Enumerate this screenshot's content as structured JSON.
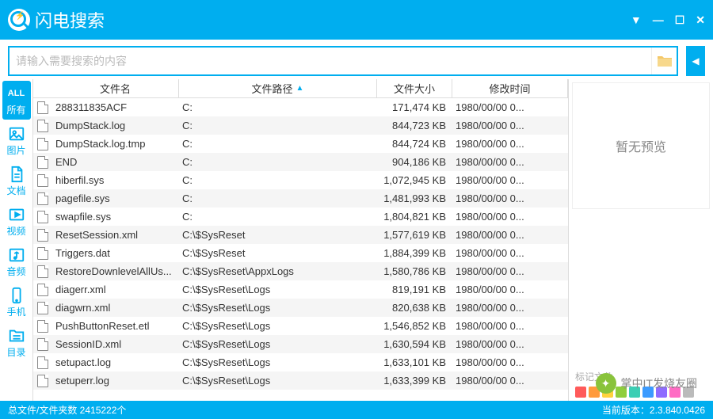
{
  "app": {
    "title": "闪电搜索"
  },
  "window_controls": {
    "menu": "▼",
    "minimize": "—",
    "maximize": "☐",
    "close": "✕"
  },
  "search": {
    "placeholder": "请输入需要搜索的内容"
  },
  "sidebar": {
    "items": [
      {
        "label": "所有",
        "icon": "ALL"
      },
      {
        "label": "图片"
      },
      {
        "label": "文档"
      },
      {
        "label": "视频"
      },
      {
        "label": "音频"
      },
      {
        "label": "手机"
      },
      {
        "label": "目录"
      }
    ]
  },
  "columns": {
    "name": "文件名",
    "path": "文件路径",
    "size": "文件大小",
    "date": "修改时间"
  },
  "rows": [
    {
      "name": "288311835ACF",
      "path": "C:",
      "size": "171,474 KB",
      "date": "1980/00/00 0..."
    },
    {
      "name": "DumpStack.log",
      "path": "C:",
      "size": "844,723 KB",
      "date": "1980/00/00 0..."
    },
    {
      "name": "DumpStack.log.tmp",
      "path": "C:",
      "size": "844,724 KB",
      "date": "1980/00/00 0..."
    },
    {
      "name": "END",
      "path": "C:",
      "size": "904,186 KB",
      "date": "1980/00/00 0..."
    },
    {
      "name": "hiberfil.sys",
      "path": "C:",
      "size": "1,072,945 KB",
      "date": "1980/00/00 0..."
    },
    {
      "name": "pagefile.sys",
      "path": "C:",
      "size": "1,481,993 KB",
      "date": "1980/00/00 0..."
    },
    {
      "name": "swapfile.sys",
      "path": "C:",
      "size": "1,804,821 KB",
      "date": "1980/00/00 0..."
    },
    {
      "name": "ResetSession.xml",
      "path": "C:\\$SysReset",
      "size": "1,577,619 KB",
      "date": "1980/00/00 0..."
    },
    {
      "name": "Triggers.dat",
      "path": "C:\\$SysReset",
      "size": "1,884,399 KB",
      "date": "1980/00/00 0..."
    },
    {
      "name": "RestoreDownlevelAllUs...",
      "path": "C:\\$SysReset\\AppxLogs",
      "size": "1,580,786 KB",
      "date": "1980/00/00 0..."
    },
    {
      "name": "diagerr.xml",
      "path": "C:\\$SysReset\\Logs",
      "size": "819,191 KB",
      "date": "1980/00/00 0..."
    },
    {
      "name": "diagwrn.xml",
      "path": "C:\\$SysReset\\Logs",
      "size": "820,638 KB",
      "date": "1980/00/00 0..."
    },
    {
      "name": "PushButtonReset.etl",
      "path": "C:\\$SysReset\\Logs",
      "size": "1,546,852 KB",
      "date": "1980/00/00 0..."
    },
    {
      "name": "SessionID.xml",
      "path": "C:\\$SysReset\\Logs",
      "size": "1,630,594 KB",
      "date": "1980/00/00 0..."
    },
    {
      "name": "setupact.log",
      "path": "C:\\$SysReset\\Logs",
      "size": "1,633,101 KB",
      "date": "1980/00/00 0..."
    },
    {
      "name": "setuperr.log",
      "path": "C:\\$SysReset\\Logs",
      "size": "1,633,399 KB",
      "date": "1980/00/00 0..."
    }
  ],
  "preview": {
    "empty": "暂无预览",
    "tag_label": "标记文件"
  },
  "tag_colors": [
    "#ff5a5a",
    "#ff9a3c",
    "#ffd23c",
    "#8fce3c",
    "#3cceb4",
    "#3c9bff",
    "#8f6cff",
    "#ff6cc4",
    "#bbbbbb"
  ],
  "status": {
    "left": "总文件/文件夹数 2415222个",
    "right": "当前版本：2.3.840.0426"
  },
  "watermark": {
    "text": "掌中IT发烧友圈"
  }
}
